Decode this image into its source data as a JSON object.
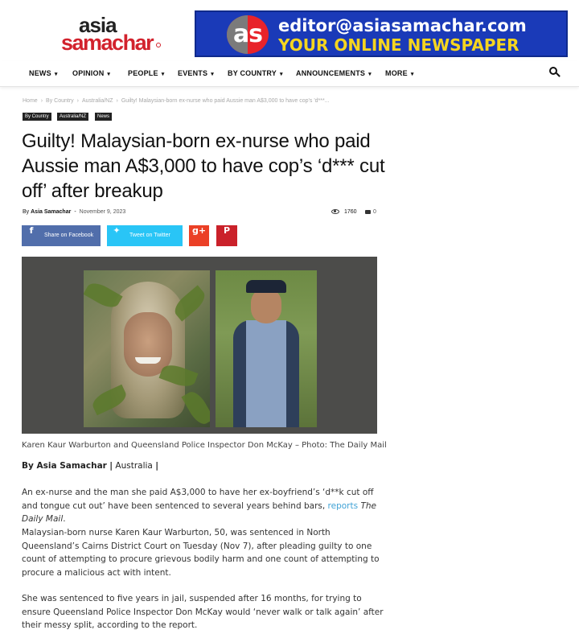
{
  "logo": {
    "line1": "asia",
    "line2": "samachar"
  },
  "banner": {
    "mark": "as",
    "email": "editor@asiasamachar.com",
    "tagline": "YOUR ONLINE NEWSPAPER",
    "background": "#1a3ab8",
    "tagline_color": "#f5d51f"
  },
  "nav": {
    "items": [
      {
        "label": "NEWS"
      },
      {
        "label": "OPINION"
      },
      {
        "label": "PEOPLE"
      },
      {
        "label": "EVENTS"
      },
      {
        "label": "BY COUNTRY"
      },
      {
        "label": "ANNOUNCEMENTS"
      },
      {
        "label": "MORE"
      }
    ],
    "search_icon": "search-icon"
  },
  "breadcrumb": [
    "Home",
    "By Country",
    "Australia/NZ",
    "Guilty! Malaysian-born ex-nurse who paid Aussie man A$3,000 to have cop's 'd***..."
  ],
  "tags": [
    "By Country",
    "Australia/NZ",
    "News"
  ],
  "article": {
    "title": "Guilty! Malaysian-born ex-nurse who paid Aussie man A$3,000 to have cop’s ‘d*** cut off’ after breakup",
    "by_prefix": "By",
    "author": "Asia Samachar",
    "date": "November 9, 2023",
    "views": "1760",
    "comments": "0"
  },
  "share": {
    "facebook": "Share on Facebook",
    "twitter": "Tweet on Twitter",
    "googleplus": "g+",
    "pinterest": "P"
  },
  "photo": {
    "caption": "Karen Kaur Warburton and Queensland Police Inspector Don McKay – Photo: The Daily Mail"
  },
  "body": {
    "byline_author": "By Asia Samachar",
    "byline_sep1": "|",
    "byline_place": "Australia",
    "byline_sep2": "|",
    "p1_text": "An ex-nurse and the man she paid A$3,000 to have her ex-boyfriend’s ‘d**k cut off and tongue cut out’ have been sentenced to several years behind bars,",
    "p1_link": "reports",
    "p1_source": "The Daily Mail",
    "p1_end": ".",
    "p2": "Malaysian-born nurse Karen Kaur Warburton, 50, was sentenced in North Queensland’s Cairns District Court on Tuesday (Nov 7), after pleading guilty to one count of attempting to procure grievous bodily harm and one count of attempting to procure a malicious act with intent.",
    "p3": "She was sentenced to five years in jail, suspended after 16 months, for trying to ensure Queensland Police Inspector Don McKay would ‘never walk or talk again’ after their messy split, according to the report."
  }
}
